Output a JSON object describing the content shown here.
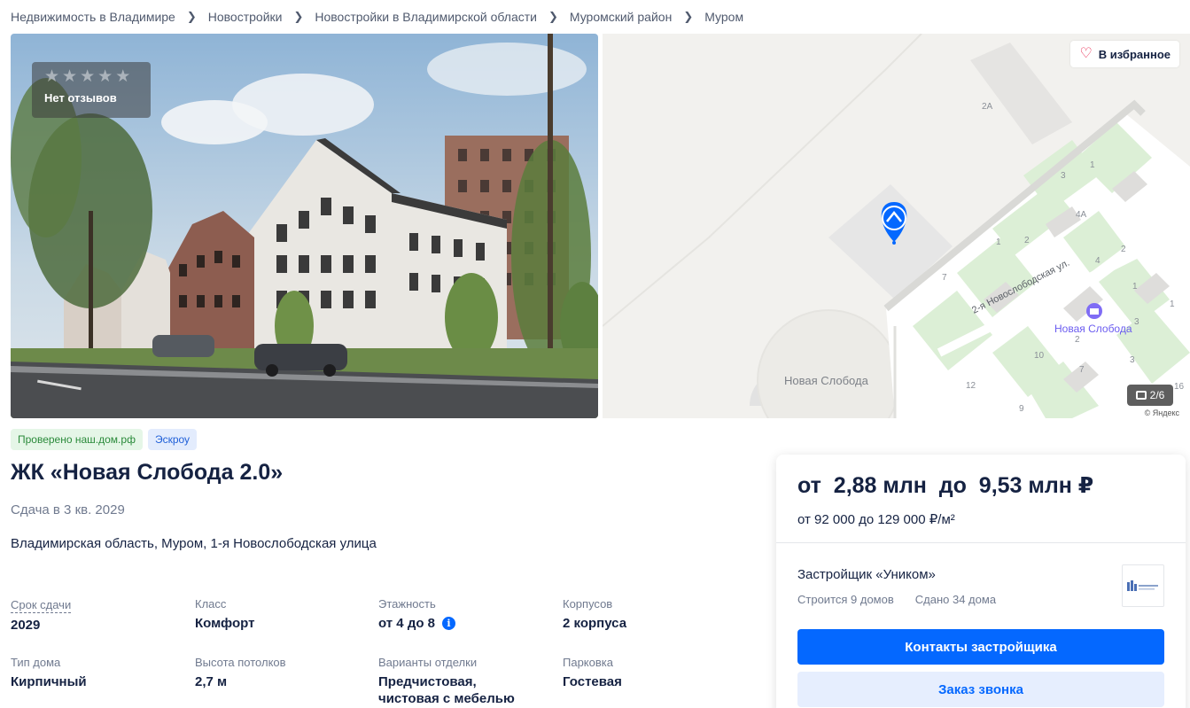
{
  "breadcrumbs": [
    "Недвижимость в Владимире",
    "Новостройки",
    "Новостройки в Владимирской области",
    "Муромский район",
    "Муром"
  ],
  "photo": {
    "rating_text": "Нет отзывов",
    "stars_filled": 0,
    "stars_total": 5
  },
  "map": {
    "favorite_label": "В избранное",
    "counter": "2/6",
    "copyright": "© Яндекс",
    "street": "2-я Новослободская ул.",
    "poi": "Новая Слобода",
    "area": "Новая Слобода",
    "house_numbers": [
      "2А",
      "1",
      "3",
      "4А",
      "2",
      "1",
      "2",
      "4",
      "7",
      "1",
      "3",
      "2",
      "12",
      "10",
      "7",
      "9",
      "3",
      "1",
      "16"
    ]
  },
  "tags": [
    "Проверено наш.дом.рф",
    "Эскроу"
  ],
  "title": "ЖК «Новая Слобода 2.0»",
  "deadline": "Сдача в 3 кв. 2029",
  "address": "Владимирская область, Муром, 1-я Новослободская улица",
  "params": [
    {
      "label": "Срок сдачи",
      "value": "2029"
    },
    {
      "label": "Класс",
      "value": "Комфорт"
    },
    {
      "label": "Этажность",
      "value": "от 4 до 8"
    },
    {
      "label": "Корпусов",
      "value": "2 корпуса"
    },
    {
      "label": "Тип дома",
      "value": "Кирпичный"
    },
    {
      "label": "Высота потолков",
      "value": "2,7 м"
    },
    {
      "label": "Варианты отделки",
      "value": "Предчистовая, чистовая с мебелью"
    },
    {
      "label": "Парковка",
      "value": "Гостевая"
    }
  ],
  "price": {
    "main": "от  2,88 млн  до  9,53 млн ₽",
    "per_sqm": "от 92 000 до 129 000 ₽/м²"
  },
  "developer": {
    "name": "Застройщик «Уником»",
    "building": "Строится 9 домов",
    "done": "Сдано 34 дома"
  },
  "buttons": {
    "contacts": "Контакты застройщика",
    "callback": "Заказ звонка"
  },
  "colors": {
    "accent": "#0468ff",
    "text": "#152242",
    "muted": "#707a8f",
    "favorite": "#e8204a"
  }
}
